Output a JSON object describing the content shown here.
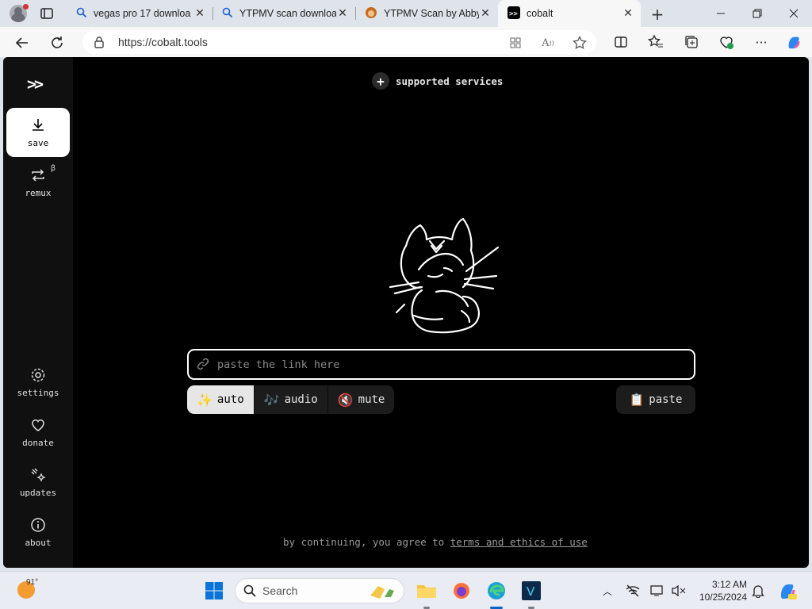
{
  "browser": {
    "tabs": [
      {
        "title": "vegas pro 17 downloa",
        "icon": "search-icon"
      },
      {
        "title": "YTPMV scan downloa",
        "icon": "search-icon"
      },
      {
        "title": "YTPMV Scan by Abby",
        "icon": "favicon-face"
      },
      {
        "title": "cobalt",
        "icon": "cobalt-favicon",
        "active": true
      }
    ],
    "url": "https://cobalt.tools"
  },
  "sidebar": {
    "logo": ">>",
    "top_items": [
      {
        "label": "save",
        "icon": "download-icon",
        "active": true
      },
      {
        "label": "remux",
        "icon": "remux-icon",
        "badge": "β"
      }
    ],
    "bottom_items": [
      {
        "label": "settings",
        "icon": "gear-icon"
      },
      {
        "label": "donate",
        "icon": "heart-icon"
      },
      {
        "label": "updates",
        "icon": "sparkle-icon"
      },
      {
        "label": "about",
        "icon": "info-icon"
      }
    ]
  },
  "main": {
    "supported_services": "supported services",
    "link_placeholder": "paste the link here",
    "modes": [
      {
        "emoji": "✨",
        "label": "auto",
        "active": true
      },
      {
        "emoji": "🎶",
        "label": "audio"
      },
      {
        "emoji": "🔇",
        "label": "mute"
      }
    ],
    "paste": {
      "emoji": "📋",
      "label": "paste"
    },
    "footer_prefix": "by continuing, you agree to ",
    "footer_link": "terms and ethics of use"
  },
  "taskbar": {
    "temperature": "91°",
    "search_label": "Search",
    "time": "3:12 AM",
    "date": "10/25/2024"
  },
  "colors": {
    "page_bg": "#000000",
    "sidebar_bg": "#101010",
    "active_item_bg": "#ffffff"
  }
}
